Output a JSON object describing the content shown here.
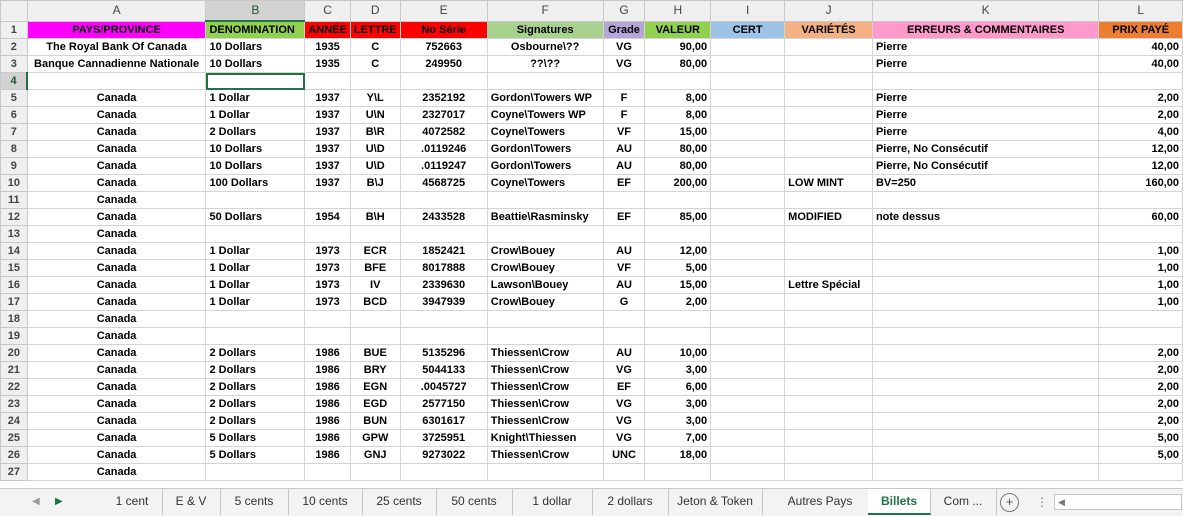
{
  "colors": {
    "pays": "#ff00ff",
    "denom": "#92d050",
    "annee": "#ff0000",
    "lettre": "#ff0000",
    "noserie": "#ff0000",
    "signatures": "#a9d18e",
    "grade": "#b4a7d6",
    "valeur": "#92d050",
    "cert": "#9dc3e6",
    "varietes": "#f4b183",
    "erreurs": "#ff99cc",
    "prix": "#ed7d31",
    "selection": "#217346"
  },
  "columns": [
    "A",
    "B",
    "C",
    "D",
    "E",
    "F",
    "G",
    "H",
    "I",
    "J",
    "K",
    "L"
  ],
  "headers": [
    "PAYS/PROVINCE",
    "DENOMINATION",
    "ANNÉE",
    "LETTRE",
    "No Série",
    "Signatures",
    "Grade",
    "VALEUR",
    "CERT",
    "VARIÉTÉS",
    "ERREURS & COMMENTAIRES",
    "PRIX PAYÉ"
  ],
  "rows": [
    {
      "num": "2",
      "cells": [
        "The Royal Bank Of Canada",
        "10 Dollars",
        "1935",
        "C",
        "752663",
        "Osbourne\\??",
        "VG",
        "90,00",
        "",
        "",
        "Pierre",
        "40,00"
      ]
    },
    {
      "num": "3",
      "cells": [
        "Banque Cannadienne Nationale",
        "10 Dollars",
        "1935",
        "C",
        "249950",
        "??\\??",
        "VG",
        "80,00",
        "",
        "",
        "Pierre",
        "40,00"
      ]
    },
    {
      "num": "4",
      "cells": [
        "",
        "",
        "",
        "",
        "",
        "",
        "",
        "",
        "",
        "",
        "",
        ""
      ]
    },
    {
      "num": "5",
      "cells": [
        "Canada",
        "1 Dollar",
        "1937",
        "Y\\L",
        "2352192",
        "Gordon\\Towers WP",
        "F",
        "8,00",
        "",
        "",
        "Pierre",
        "2,00"
      ]
    },
    {
      "num": "6",
      "cells": [
        "Canada",
        "1 Dollar",
        "1937",
        "U\\N",
        "2327017",
        "Coyne\\Towers WP",
        "F",
        "8,00",
        "",
        "",
        "Pierre",
        "2,00"
      ]
    },
    {
      "num": "7",
      "cells": [
        "Canada",
        "2 Dollars",
        "1937",
        "B\\R",
        "4072582",
        "Coyne\\Towers",
        "VF",
        "15,00",
        "",
        "",
        "Pierre",
        "4,00"
      ]
    },
    {
      "num": "8",
      "cells": [
        "Canada",
        "10 Dollars",
        "1937",
        "U\\D",
        ".0119246",
        "Gordon\\Towers",
        "AU",
        "80,00",
        "",
        "",
        "Pierre, No Consécutif",
        "12,00"
      ]
    },
    {
      "num": "9",
      "cells": [
        "Canada",
        "10 Dollars",
        "1937",
        "U\\D",
        ".0119247",
        "Gordon\\Towers",
        "AU",
        "80,00",
        "",
        "",
        "Pierre, No Consécutif",
        "12,00"
      ]
    },
    {
      "num": "10",
      "cells": [
        "Canada",
        "100 Dollars",
        "1937",
        "B\\J",
        "4568725",
        "Coyne\\Towers",
        "EF",
        "200,00",
        "",
        "LOW MINT",
        "BV=250",
        "160,00"
      ]
    },
    {
      "num": "11",
      "cells": [
        "Canada",
        "",
        "",
        "",
        "",
        "",
        "",
        "",
        "",
        "",
        "",
        ""
      ]
    },
    {
      "num": "12",
      "cells": [
        "Canada",
        "50 Dollars",
        "1954",
        "B\\H",
        "2433528",
        "Beattie\\Rasminsky",
        "EF",
        "85,00",
        "",
        "MODIFIED",
        "note dessus",
        "60,00"
      ]
    },
    {
      "num": "13",
      "cells": [
        "Canada",
        "",
        "",
        "",
        "",
        "",
        "",
        "",
        "",
        "",
        "",
        ""
      ]
    },
    {
      "num": "14",
      "cells": [
        "Canada",
        "1 Dollar",
        "1973",
        "ECR",
        "1852421",
        "Crow\\Bouey",
        "AU",
        "12,00",
        "",
        "",
        "",
        "1,00"
      ]
    },
    {
      "num": "15",
      "cells": [
        "Canada",
        "1 Dollar",
        "1973",
        "BFE",
        "8017888",
        "Crow\\Bouey",
        "VF",
        "5,00",
        "",
        "",
        "",
        "1,00"
      ]
    },
    {
      "num": "16",
      "cells": [
        "Canada",
        "1 Dollar",
        "1973",
        "IV",
        "2339630",
        "Lawson\\Bouey",
        "AU",
        "15,00",
        "",
        "Lettre Spécial",
        "",
        "1,00"
      ]
    },
    {
      "num": "17",
      "cells": [
        "Canada",
        "1 Dollar",
        "1973",
        "BCD",
        "3947939",
        "Crow\\Bouey",
        "G",
        "2,00",
        "",
        "",
        "",
        "1,00"
      ]
    },
    {
      "num": "18",
      "cells": [
        "Canada",
        "",
        "",
        "",
        "",
        "",
        "",
        "",
        "",
        "",
        "",
        ""
      ]
    },
    {
      "num": "19",
      "cells": [
        "Canada",
        "",
        "",
        "",
        "",
        "",
        "",
        "",
        "",
        "",
        "",
        ""
      ]
    },
    {
      "num": "20",
      "cells": [
        "Canada",
        "2 Dollars",
        "1986",
        "BUE",
        "5135296",
        "Thiessen\\Crow",
        "AU",
        "10,00",
        "",
        "",
        "",
        "2,00"
      ]
    },
    {
      "num": "21",
      "cells": [
        "Canada",
        "2 Dollars",
        "1986",
        "BRY",
        "5044133",
        "Thiessen\\Crow",
        "VG",
        "3,00",
        "",
        "",
        "",
        "2,00"
      ]
    },
    {
      "num": "22",
      "cells": [
        "Canada",
        "2 Dollars",
        "1986",
        "EGN",
        ".0045727",
        "Thiessen\\Crow",
        "EF",
        "6,00",
        "",
        "",
        "",
        "2,00"
      ]
    },
    {
      "num": "23",
      "cells": [
        "Canada",
        "2 Dollars",
        "1986",
        "EGD",
        "2577150",
        "Thiessen\\Crow",
        "VG",
        "3,00",
        "",
        "",
        "",
        "2,00"
      ]
    },
    {
      "num": "24",
      "cells": [
        "Canada",
        "2 Dollars",
        "1986",
        "BUN",
        "6301617",
        "Thiessen\\Crow",
        "VG",
        "3,00",
        "",
        "",
        "",
        "2,00"
      ]
    },
    {
      "num": "25",
      "cells": [
        "Canada",
        "5 Dollars",
        "1986",
        "GPW",
        "3725951",
        "Knight\\Thiessen",
        "VG",
        "7,00",
        "",
        "",
        "",
        "5,00"
      ]
    },
    {
      "num": "26",
      "cells": [
        "Canada",
        "5 Dollars",
        "1986",
        "GNJ",
        "9273022",
        "Thiessen\\Crow",
        "UNC",
        "18,00",
        "",
        "",
        "",
        "5,00"
      ]
    },
    {
      "num": "27",
      "cells": [
        "Canada",
        "",
        "",
        "",
        "",
        "",
        "",
        "",
        "",
        "",
        "",
        ""
      ]
    }
  ],
  "tabs": [
    {
      "label": "1 cent",
      "active": false
    },
    {
      "label": "E & V",
      "active": false
    },
    {
      "label": "5 cents",
      "active": false
    },
    {
      "label": "10 cents",
      "active": false
    },
    {
      "label": "25 cents",
      "active": false
    },
    {
      "label": "50 cents",
      "active": false
    },
    {
      "label": "1 dollar",
      "active": false
    },
    {
      "label": "2 dollars",
      "active": false
    },
    {
      "label": "Jeton & Token",
      "active": false
    },
    {
      "label": "Autres Pays",
      "active": false
    },
    {
      "label": "Billets",
      "active": true
    },
    {
      "label": "Com ...",
      "active": false
    }
  ],
  "icons": {
    "prev": "triangle-left-icon",
    "next": "triangle-right-icon",
    "add": "plus-circle-icon",
    "more": "vertical-ellipsis-icon",
    "scroll": "scroll-left-icon"
  }
}
